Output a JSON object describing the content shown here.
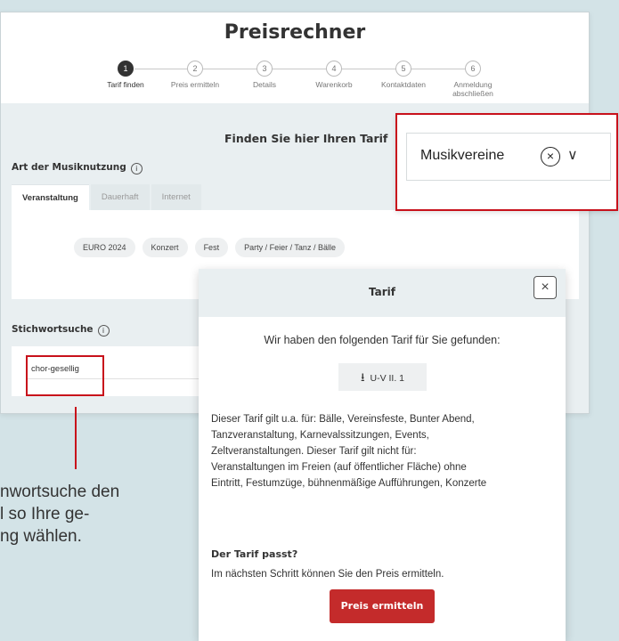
{
  "header": {
    "title": "Preisrechner"
  },
  "steps": [
    {
      "num": "1",
      "label": "Tarif finden"
    },
    {
      "num": "2",
      "label": "Preis ermitteln"
    },
    {
      "num": "3",
      "label": "Details"
    },
    {
      "num": "4",
      "label": "Warenkorb"
    },
    {
      "num": "5",
      "label": "Kontaktdaten"
    },
    {
      "num": "6",
      "label": "Anmeldung abschließen"
    }
  ],
  "finder": {
    "heading": "Finden Sie hier Ihren Tarif",
    "usage_label": "Art der Musiknutzung",
    "info_icon": "i",
    "tabs": [
      "Veranstaltung",
      "Dauerhaft",
      "Internet"
    ],
    "chips": [
      "EURO 2024",
      "Konzert",
      "Fest",
      "Party / Feier / Tanz / Bälle"
    ],
    "search_label": "Stichwortsuche",
    "search_value": "chor-gesellig"
  },
  "dropdown": {
    "value": "Musikvereine",
    "clear_glyph": "×",
    "chevron_glyph": "∨"
  },
  "callout": {
    "lines": [
      "nwortsuche den",
      "l so Ihre ge-",
      "ng wählen."
    ]
  },
  "modal": {
    "title": "Tarif",
    "close_glyph": "×",
    "found_text": "Wir haben den folgenden Tarif für Sie gefunden:",
    "tarif_code": "U-V II. 1",
    "download_glyph": "⭳",
    "description_lines": [
      "Dieser Tarif gilt u.a. für: Bälle, Vereinsfeste, Bunter Abend,",
      "Tanzveranstaltung, Karnevalssitzungen, Events,",
      "Zeltveranstaltungen. Dieser Tarif gilt nicht für:",
      "Veranstaltungen im Freien (auf öffentlicher Fläche) ohne",
      "Eintritt, Festumzüge, bühnenmäßige Aufführungen, Konzerte"
    ],
    "question": "Der Tarif passt?",
    "next_hint": "Im nächsten Schritt können Sie den Preis ermitteln.",
    "button_label": "Preis ermitteln"
  },
  "colors": {
    "accent_red": "#c42b2b",
    "highlight_red": "#c8111b",
    "background": "#d3e3e7"
  }
}
